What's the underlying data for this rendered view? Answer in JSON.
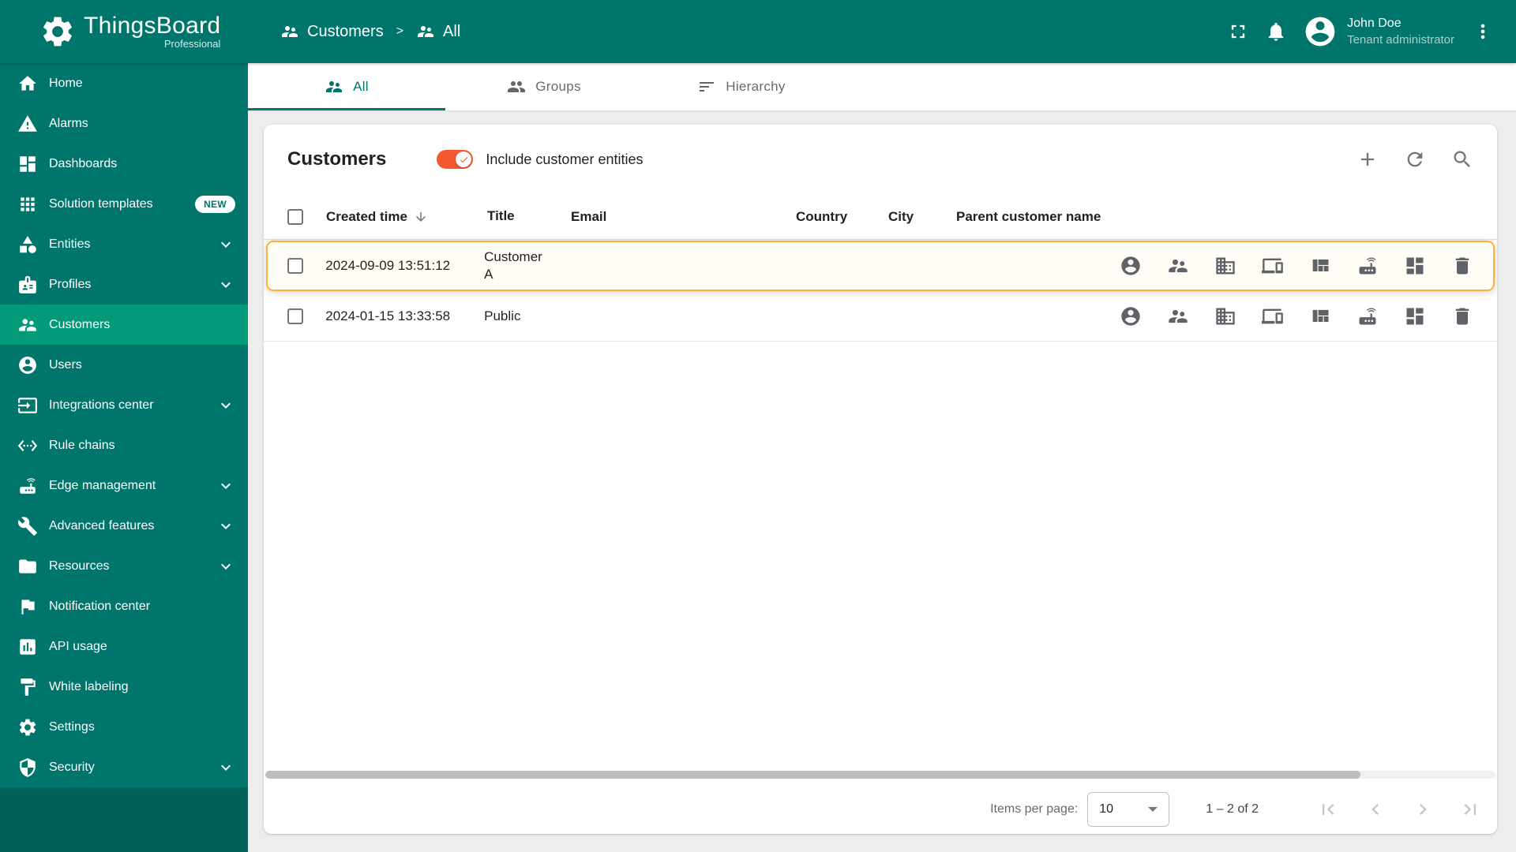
{
  "app": {
    "name": "ThingsBoard",
    "edition": "Professional"
  },
  "header": {
    "breadcrumb": [
      {
        "label": "Customers"
      },
      {
        "label": "All"
      }
    ],
    "breadcrumb_separator": ">",
    "user": {
      "name": "John Doe",
      "role": "Tenant administrator"
    }
  },
  "sidebar": {
    "items": [
      {
        "label": "Home"
      },
      {
        "label": "Alarms"
      },
      {
        "label": "Dashboards"
      },
      {
        "label": "Solution templates",
        "badge": "NEW"
      },
      {
        "label": "Entities",
        "expandable": true
      },
      {
        "label": "Profiles",
        "expandable": true
      },
      {
        "label": "Customers",
        "active": true
      },
      {
        "label": "Users"
      },
      {
        "label": "Integrations center",
        "expandable": true
      },
      {
        "label": "Rule chains"
      },
      {
        "label": "Edge management",
        "expandable": true
      },
      {
        "label": "Advanced features",
        "expandable": true
      },
      {
        "label": "Resources",
        "expandable": true
      },
      {
        "label": "Notification center"
      },
      {
        "label": "API usage"
      },
      {
        "label": "White labeling"
      },
      {
        "label": "Settings"
      },
      {
        "label": "Security",
        "expandable": true
      }
    ]
  },
  "tabs": [
    {
      "label": "All",
      "active": true
    },
    {
      "label": "Groups",
      "active": false
    },
    {
      "label": "Hierarchy",
      "active": false
    }
  ],
  "card": {
    "title": "Customers",
    "toggle_label": "Include customer entities",
    "toggle_on": true
  },
  "table": {
    "columns": [
      "Created time",
      "Title",
      "Email",
      "Country",
      "City",
      "Parent customer name"
    ],
    "rows": [
      {
        "created_time": "2024-09-09 13:51:12",
        "title": "Customer A",
        "email": "",
        "country": "",
        "city": "",
        "parent_customer_name": "",
        "highlighted": true
      },
      {
        "created_time": "2024-01-15 13:33:58",
        "title": "Public",
        "email": "",
        "country": "",
        "city": "",
        "parent_customer_name": "",
        "highlighted": false
      }
    ],
    "row_actions": [
      "manage-users",
      "manage-customers",
      "manage-assets",
      "manage-devices",
      "manage-entity-views",
      "manage-edge-instances",
      "manage-dashboards",
      "delete"
    ]
  },
  "pagination": {
    "items_per_page_label": "Items per page:",
    "items_per_page_value": "10",
    "range": "1 – 2 of 2"
  },
  "colors": {
    "primary_green": "#00756b",
    "active_item_green": "#029a78",
    "toggle_orange": "#f4592e",
    "highlight_border": "#ffae3b"
  }
}
